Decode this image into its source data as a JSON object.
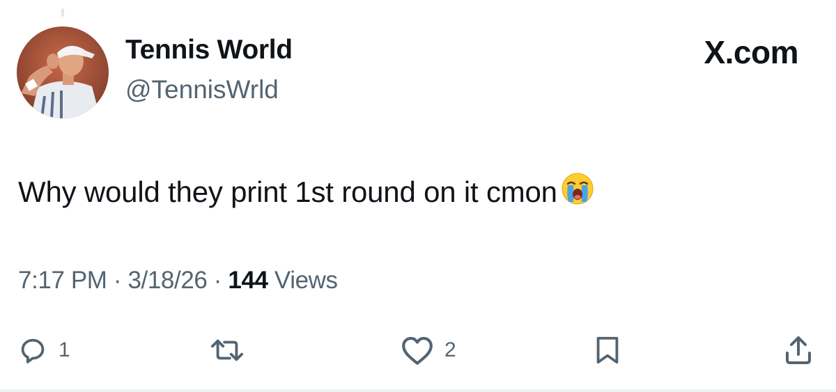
{
  "author": {
    "name": "Tennis World",
    "handle": "@TennisWrld"
  },
  "brand": {
    "label": "X.com"
  },
  "tweet": {
    "text": "Why would they print 1st round on it cmon",
    "emoji": "loudly-crying-face"
  },
  "meta": {
    "time": "7:17 PM",
    "sep1": "·",
    "date": "3/18/26",
    "sep2": "·",
    "views_count": "144",
    "views_label": "Views"
  },
  "actions": {
    "reply_count": "1",
    "like_count": "2"
  },
  "icons": {
    "reply": "reply-icon",
    "retweet": "retweet-icon",
    "like": "heart-icon",
    "bookmark": "bookmark-icon",
    "share": "share-icon"
  },
  "colors": {
    "text_primary": "#0f1419",
    "text_secondary": "#536471",
    "divider": "#eff3f4"
  }
}
